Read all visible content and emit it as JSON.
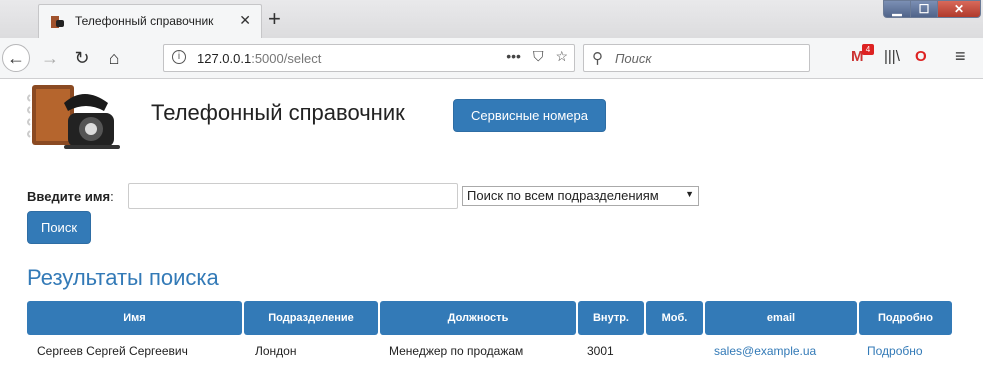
{
  "browser": {
    "tab_title": "Телефонный справочник",
    "tab_close": "✕",
    "new_tab": "+",
    "url_host": "127.0.0.1",
    "url_rest": ":5000/select",
    "search_placeholder": "Поиск",
    "mail_badge": "4",
    "window_min": "▁",
    "window_max": "☐",
    "window_close": "✕"
  },
  "header": {
    "title": "Телефонный справочник",
    "service_button": "Сервисные номера"
  },
  "search_form": {
    "name_label": "Введите имя",
    "name_label_suffix": ":",
    "name_value": "",
    "department_selected": "Поиск по всем подразделениям",
    "submit_label": "Поиск"
  },
  "results": {
    "title": "Результаты поиска",
    "columns": [
      "Имя",
      "Подразделение",
      "Должность",
      "Внутр.",
      "Моб.",
      "email",
      "Подробно"
    ],
    "rows": [
      {
        "name": "Сергеев Сергей Сергеевич",
        "department": "Лондон",
        "position": "Менеджер по продажам",
        "ext": "3001",
        "mobile": "",
        "email": "sales@example.ua",
        "details": "Подробно"
      }
    ]
  },
  "colors": {
    "primary": "#337ab7",
    "primary_border": "#2e6da4"
  }
}
